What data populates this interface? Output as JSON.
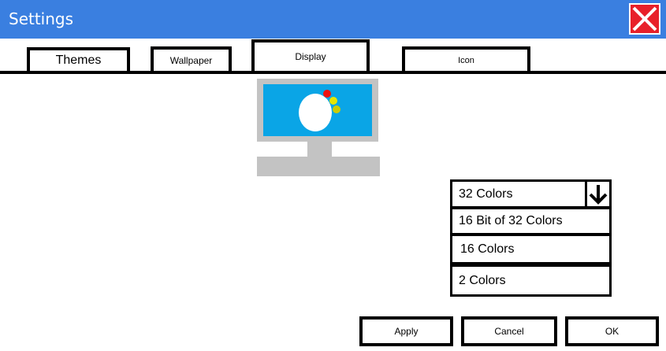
{
  "window": {
    "title": "Settings"
  },
  "tabs": [
    {
      "label": "Themes"
    },
    {
      "label": "Wallpaper"
    },
    {
      "label": "Display"
    },
    {
      "label": "Icon"
    }
  ],
  "color_depth": {
    "selected": "32 Colors",
    "options": [
      "16 Bit of 32 Colors",
      "16 Colors",
      "2 Colors"
    ]
  },
  "buttons": {
    "apply": "Apply",
    "cancel": "Cancel",
    "ok": "OK"
  },
  "colors": {
    "titlebar": "#3a7fe0",
    "close": "#e8202a",
    "screen": "#0aa5e6",
    "monitor_frame": "#c3c3c3"
  },
  "icons": {
    "close": "close-icon",
    "dropdown": "arrow-down-icon"
  }
}
